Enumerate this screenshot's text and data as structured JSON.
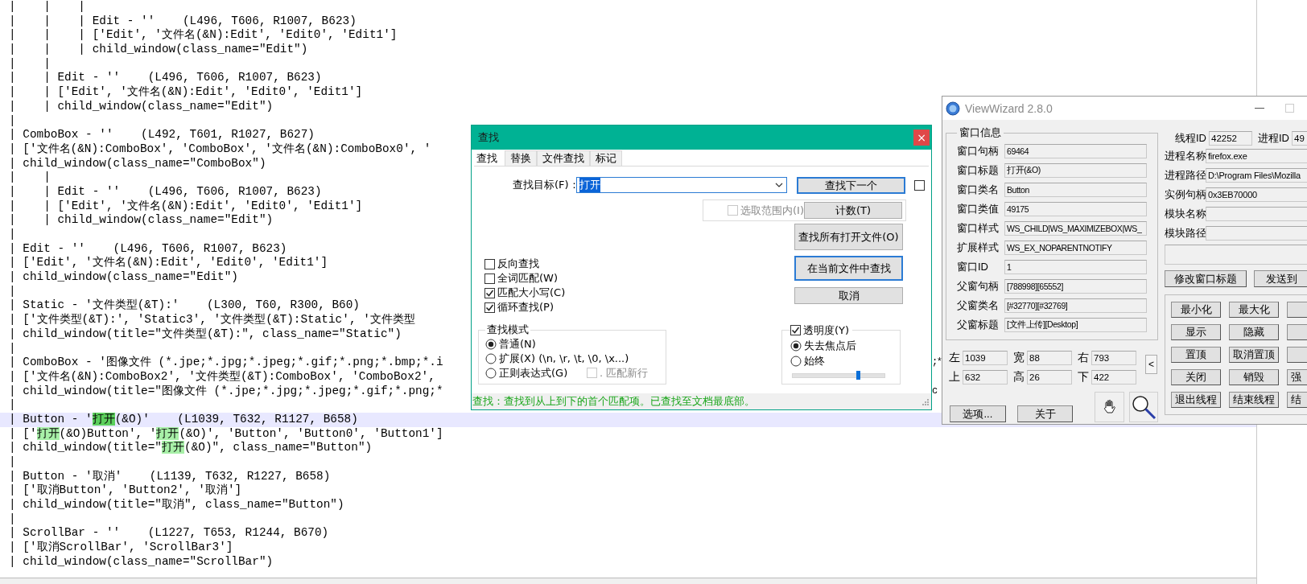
{
  "editor": {
    "lines": [
      {
        "text": "|    |    |",
        "current": false
      },
      {
        "text": "|    |    | Edit - ''    (L496, T606, R1007, B623)",
        "current": false
      },
      {
        "text": "|    |    | ['Edit', '文件名(&N):Edit', 'Edit0', 'Edit1']",
        "current": false
      },
      {
        "text": "|    |    | child_window(class_name=\"Edit\")",
        "current": false
      },
      {
        "text": "|    |",
        "current": false
      },
      {
        "text": "|    | Edit - ''    (L496, T606, R1007, B623)",
        "current": false
      },
      {
        "text": "|    | ['Edit', '文件名(&N):Edit', 'Edit0', 'Edit1']",
        "current": false
      },
      {
        "text": "|    | child_window(class_name=\"Edit\")",
        "current": false
      },
      {
        "text": "|",
        "current": false
      },
      {
        "text": "| ComboBox - ''    (L492, T601, R1027, B627)",
        "current": false
      },
      {
        "text": "| ['文件名(&N):ComboBox', 'ComboBox', '文件名(&N):ComboBox0', '",
        "current": false
      },
      {
        "text": "| child_window(class_name=\"ComboBox\")",
        "current": false
      },
      {
        "text": "|    |",
        "current": false
      },
      {
        "text": "|    | Edit - ''    (L496, T606, R1007, B623)",
        "current": false
      },
      {
        "text": "|    | ['Edit', '文件名(&N):Edit', 'Edit0', 'Edit1']",
        "current": false
      },
      {
        "text": "|    | child_window(class_name=\"Edit\")",
        "current": false
      },
      {
        "text": "|",
        "current": false
      },
      {
        "text": "| Edit - ''    (L496, T606, R1007, B623)",
        "current": false
      },
      {
        "text": "| ['Edit', '文件名(&N):Edit', 'Edit0', 'Edit1']",
        "current": false
      },
      {
        "text": "| child_window(class_name=\"Edit\")",
        "current": false
      },
      {
        "text": "|",
        "current": false
      },
      {
        "text": "| Static - '文件类型(&T):'    (L300, T60, R300, B60)",
        "current": false
      },
      {
        "text": "| ['文件类型(&T):', 'Static3', '文件类型(&T):Static', '文件类型",
        "current": false
      },
      {
        "text": "| child_window(title=\"文件类型(&T):\", class_name=\"Static\")",
        "current": false
      },
      {
        "text": "|",
        "current": false
      },
      {
        "text": "| ComboBox - '图像文件 (*.jpe;*.jpg;*.jpeg;*.gif;*.png;*.bmp;*.i",
        "tail": ";*",
        "current": false
      },
      {
        "text": "| ['文件名(&N):ComboBox2', '文件类型(&T):ComboBox', 'ComboBox2',",
        "current": false
      },
      {
        "text": "| child_window(title=\"图像文件 (*.jpe;*.jpg;*.jpeg;*.gif;*.png;*",
        "tail": "c",
        "current": false
      },
      {
        "text": "|",
        "current": false
      },
      {
        "segs": [
          {
            "t": "| Button - '",
            "match": false
          },
          {
            "t": "打开",
            "match": true
          },
          {
            "t": "(&O)'    (L1039, T632, R1127, B658)",
            "match": false
          }
        ],
        "current": true
      },
      {
        "segs": [
          {
            "t": "| ['",
            "match": false
          },
          {
            "t": "打开",
            "match": true
          },
          {
            "t": "(&O)Button', '",
            "match": false
          },
          {
            "t": "打开",
            "match": true
          },
          {
            "t": "(&O)', 'Button', 'Button0', 'Button1']",
            "match": false
          }
        ],
        "current": false
      },
      {
        "segs": [
          {
            "t": "| child_window(title=\"",
            "match": false
          },
          {
            "t": "打开",
            "match": true
          },
          {
            "t": "(&O)\", class_name=\"Button\")",
            "match": false
          }
        ],
        "current": false
      },
      {
        "text": "|",
        "current": false
      },
      {
        "text": "| Button - '取消'    (L1139, T632, R1227, B658)",
        "current": false
      },
      {
        "text": "| ['取消Button', 'Button2', '取消']",
        "current": false
      },
      {
        "text": "| child_window(title=\"取消\", class_name=\"Button\")",
        "current": false
      },
      {
        "text": "|",
        "current": false
      },
      {
        "text": "| ScrollBar - ''    (L1227, T653, R1244, B670)",
        "current": false
      },
      {
        "text": "| ['取消ScrollBar', 'ScrollBar3']",
        "current": false
      },
      {
        "text": "| child_window(class_name=\"ScrollBar\")",
        "current": false
      }
    ]
  },
  "find_dialog": {
    "title": "查找",
    "close": "×",
    "tabs": [
      {
        "label": "查找",
        "selected": true
      },
      {
        "label": "替换",
        "selected": false
      },
      {
        "label": "文件查找",
        "selected": false
      },
      {
        "label": "标记",
        "selected": false
      }
    ],
    "target": {
      "label": "查找目标(F)：",
      "value": "打开"
    },
    "find_next": {
      "label": "查找下一个",
      "focused": true
    },
    "pin_checked": false,
    "in_selection": {
      "label": "选取范围内(I)",
      "checked": false,
      "disabled": true
    },
    "count": {
      "label": "计数(T)",
      "focused": false
    },
    "find_all_open": {
      "label": "查找所有打开文件(O)",
      "focused": false
    },
    "find_in_current": {
      "label": "在当前文件中查找",
      "focused": true
    },
    "cancel": {
      "label": "取消",
      "focused": false
    },
    "options": [
      {
        "label": "反向查找",
        "checked": false
      },
      {
        "label": "全词匹配(W)",
        "checked": false
      },
      {
        "label": "匹配大小写(C)",
        "checked": true
      },
      {
        "label": "循环查找(P)",
        "checked": true
      }
    ],
    "mode": {
      "title": "查找模式",
      "options": [
        {
          "label": "普通(N)",
          "selected": true
        },
        {
          "label": "扩展(X) (\\n, \\r, \\t, \\0, \\x...)",
          "selected": false
        },
        {
          "label": "正则表达式(G)",
          "selected": false
        }
      ],
      "newline": {
        "label": ". 匹配新行",
        "checked": false,
        "disabled": true
      }
    },
    "transparency": {
      "label": "透明度(Y)",
      "checked": true,
      "options": [
        {
          "label": "失去焦点后",
          "selected": true
        },
        {
          "label": "始终",
          "selected": false
        }
      ],
      "level": 0.71
    },
    "status": "查找：查找到从上到下的首个匹配项。已查找至文档最底部。"
  },
  "viewwizard": {
    "title": "ViewWizard 2.8.0",
    "group": "窗口信息",
    "info": [
      {
        "label": "窗口句柄",
        "value": "69464"
      },
      {
        "label": "窗口标题",
        "value": "打开(&O)"
      },
      {
        "label": "窗口类名",
        "value": "Button"
      },
      {
        "label": "窗口类值",
        "value": "49175"
      },
      {
        "label": "窗口样式",
        "value": "WS_CHILD|WS_MAXIMIZEBOX|WS_"
      },
      {
        "label": "扩展样式",
        "value": "WS_EX_NOPARENTNOTIFY"
      },
      {
        "label": "窗口ID",
        "value": "1"
      },
      {
        "label": "父窗句柄",
        "value": "[788998][65552]"
      },
      {
        "label": "父窗类名",
        "value": "[#32770][#32769]"
      },
      {
        "label": "父窗标题",
        "value": "[文件上传][Desktop]"
      }
    ],
    "thread": {
      "label": "线程ID",
      "value": "42252"
    },
    "process_id": {
      "label": "进程ID",
      "value": "49"
    },
    "process": [
      {
        "label": "进程名称",
        "value": "firefox.exe"
      },
      {
        "label": "进程路径",
        "value": "D:\\Program Files\\Mozilla"
      },
      {
        "label": "实例句柄",
        "value": "0x3EB70000"
      },
      {
        "label": "模块名称"
      },
      {
        "label": "模块路径"
      }
    ],
    "rename": "修改窗口标题",
    "send": "发送到",
    "actions": [
      {
        "label": "最小化"
      },
      {
        "label": "最大化"
      },
      {
        "label": "显示"
      },
      {
        "label": "隐藏"
      },
      {
        "label": "置顶"
      },
      {
        "label": "取消置顶"
      },
      {
        "label": "关闭"
      },
      {
        "label": "销毁"
      },
      {
        "label": "退出线程"
      },
      {
        "label": "结束线程"
      }
    ],
    "actions_column_3": [
      {
        "label": "强"
      },
      {
        "label": "结"
      }
    ],
    "coords": [
      {
        "label": "左",
        "value": "1039"
      },
      {
        "label": "宽",
        "value": "88"
      },
      {
        "label": "右",
        "value": "793"
      },
      {
        "label": "上",
        "value": "632"
      },
      {
        "label": "高",
        "value": "26"
      },
      {
        "label": "下",
        "value": "422"
      }
    ],
    "collapse": "<",
    "options_button": "选项...",
    "about": "关于"
  }
}
